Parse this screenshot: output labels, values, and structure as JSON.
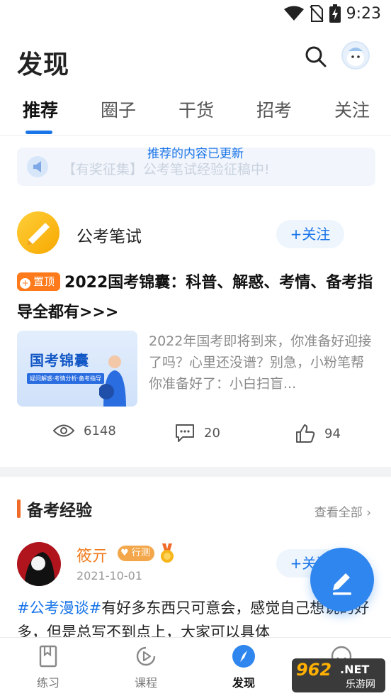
{
  "status_bar": {
    "time": "9:23"
  },
  "header": {
    "title": "发现"
  },
  "tabs": [
    {
      "label": "推荐",
      "active": true
    },
    {
      "label": "圈子"
    },
    {
      "label": "干货"
    },
    {
      "label": "招考"
    },
    {
      "label": "关注"
    }
  ],
  "notice": {
    "text": "【有奖征集】公考笔试经验征稿中!",
    "toast": "推荐的内容已更新"
  },
  "post": {
    "circle_name": "公考笔试",
    "follow_label": "+关注",
    "pin_label": "置顶",
    "pin_mark": "+",
    "title": "2022国考锦囊：科普、解惑、考情、备考指导全都有>>>",
    "thumb_title": "国考锦囊",
    "thumb_subtitle": "疑问解惑·考情分析·备考指导",
    "excerpt": "2022年国考即将到来，你准备好迎接了吗？心里还没谱？别急，小粉笔帮你准备好了：小白扫盲...",
    "views": "6148",
    "comments": "20",
    "likes": "94"
  },
  "section": {
    "title": "备考经验",
    "see_all": "查看全部 ›"
  },
  "post2": {
    "author": "筱亓",
    "tag": "行测",
    "date": "2021-10-01",
    "follow_label": "+关注",
    "hashtag": "#公考漫谈#",
    "text": "有好多东西只可意会，感觉自己想说的好多，但是总写不到点上，大家可以具体"
  },
  "bottom_nav": [
    {
      "label": "练习"
    },
    {
      "label": "课程"
    },
    {
      "label": "发现",
      "active": true
    },
    {
      "label": "我的"
    }
  ],
  "watermark": {
    "num": "962",
    "net": ".NET",
    "sub": "乐游网"
  },
  "colors": {
    "accent": "#1a75e8",
    "orange": "#f06b28",
    "fab": "#2f86ee"
  }
}
